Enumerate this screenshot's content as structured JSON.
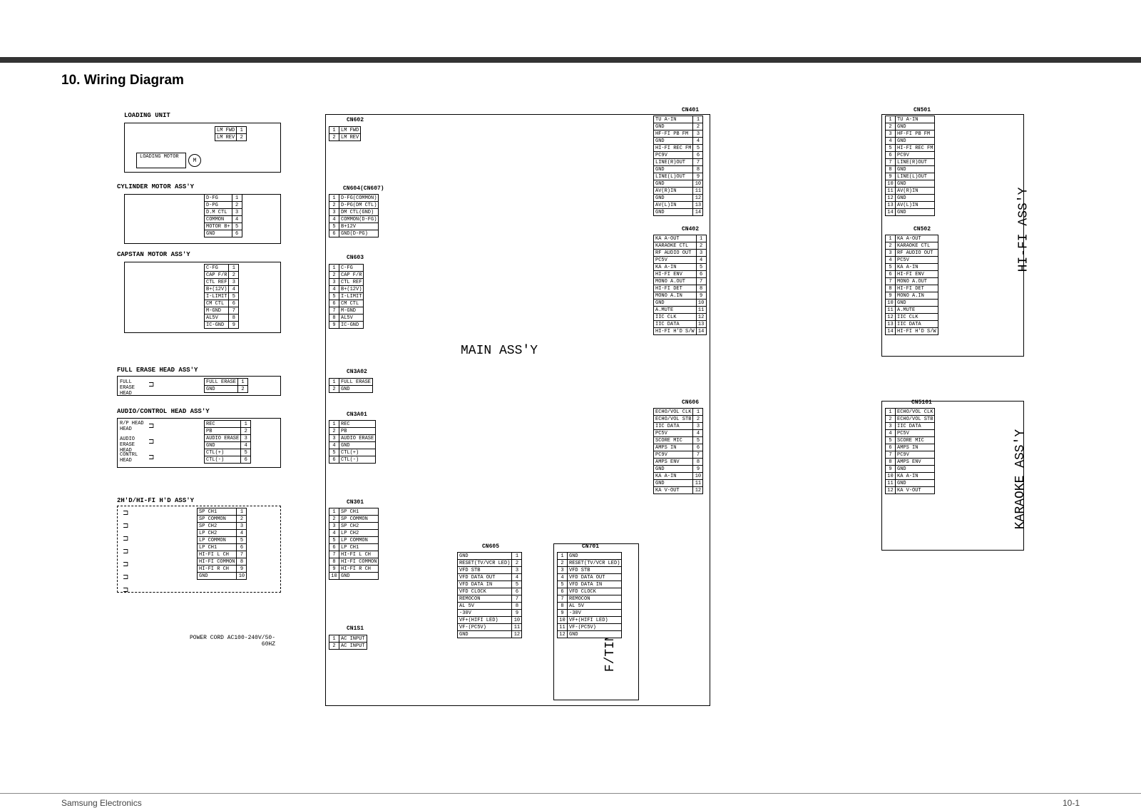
{
  "page": {
    "title": "10. Wiring Diagram",
    "footer_left": "Samsung Electronics",
    "footer_right": "10-1"
  },
  "diagram": {
    "main_assy": "MAIN ASS'Y",
    "ft_assy": "F/TIMER ASS'Y",
    "hifi_assy": "HI-FI ASS'Y",
    "karaoke_assy": "KARAOKE ASS'Y"
  },
  "sections": {
    "loading_unit": "LOADING UNIT",
    "loading_motor": "LOADING MOTOR",
    "cylinder_motor": "CYLINDER MOTOR ASS'Y",
    "capstan_motor": "CAPSTAN MOTOR ASS'Y",
    "full_erase": "FULL ERASE HEAD ASS'Y",
    "full_erase_head": "FULL ERASE HEAD",
    "audio_control": "AUDIO/CONTROL HEAD ASS'Y",
    "rp_head": "R/P HEAD HEAD",
    "audio_erase": "AUDIO ERASE HEAD",
    "control_head": "CONTRL HEAD",
    "hifi_hd": "2H'D/HI-FI H'D ASS'Y",
    "power_cord": "POWER CORD AC100-240V/50-60HZ"
  },
  "connectors": {
    "cn602": {
      "name": "CN602",
      "left": [
        {
          "n": "1",
          "t": "LM FWD"
        },
        {
          "n": "2",
          "t": "LM REV"
        }
      ],
      "right": [
        {
          "n": "1",
          "t": "LM FWD"
        },
        {
          "n": "2",
          "t": "LM REV"
        }
      ]
    },
    "cn604": {
      "name": "CN604(CN607)",
      "left": [
        {
          "n": "1",
          "t": "D-FG"
        },
        {
          "n": "2",
          "t": "D-PG"
        },
        {
          "n": "3",
          "t": "D.M CTL"
        },
        {
          "n": "4",
          "t": "COMMON"
        },
        {
          "n": "5",
          "t": "MOTOR B+"
        },
        {
          "n": "6",
          "t": "GND"
        }
      ],
      "right": [
        {
          "n": "1",
          "t": "D-FG(COMMON)"
        },
        {
          "n": "2",
          "t": "D-PG(DM CTL)"
        },
        {
          "n": "3",
          "t": "DM CTL(GND)"
        },
        {
          "n": "4",
          "t": "COMMON(D-FG)"
        },
        {
          "n": "5",
          "t": "B+12V"
        },
        {
          "n": "6",
          "t": "GND(D-PG)"
        }
      ]
    },
    "cn603": {
      "name": "CN603",
      "left": [
        {
          "n": "1",
          "t": "C-FG"
        },
        {
          "n": "2",
          "t": "CAP F/R"
        },
        {
          "n": "3",
          "t": "CTL REF"
        },
        {
          "n": "4",
          "t": "B+(12V)"
        },
        {
          "n": "5",
          "t": "I-LIMIT"
        },
        {
          "n": "6",
          "t": "CM CTL"
        },
        {
          "n": "7",
          "t": "M-GND"
        },
        {
          "n": "8",
          "t": "AL5V"
        },
        {
          "n": "9",
          "t": "IC-GND"
        }
      ],
      "right": [
        {
          "n": "1",
          "t": "C-FG"
        },
        {
          "n": "2",
          "t": "CAP F/R"
        },
        {
          "n": "3",
          "t": "CTL REF"
        },
        {
          "n": "4",
          "t": "B+(12V)"
        },
        {
          "n": "5",
          "t": "I-LIMIT"
        },
        {
          "n": "6",
          "t": "CM CTL"
        },
        {
          "n": "7",
          "t": "M-GND"
        },
        {
          "n": "8",
          "t": "AL5V"
        },
        {
          "n": "9",
          "t": "IC-GND"
        }
      ]
    },
    "cn3a02": {
      "name": "CN3A02",
      "left": [
        {
          "n": "1",
          "t": "FULL ERASE"
        },
        {
          "n": "2",
          "t": "GND"
        }
      ],
      "right": [
        {
          "n": "1",
          "t": "FULL ERASE"
        },
        {
          "n": "2",
          "t": "GND"
        }
      ]
    },
    "cn3a01": {
      "name": "CN3A01",
      "left": [
        {
          "n": "1",
          "t": "REC"
        },
        {
          "n": "2",
          "t": "PB"
        },
        {
          "n": "3",
          "t": "AUDIO ERASE"
        },
        {
          "n": "4",
          "t": "GND"
        },
        {
          "n": "5",
          "t": "CTL(+)"
        },
        {
          "n": "6",
          "t": "CTL(-)"
        }
      ],
      "right": [
        {
          "n": "1",
          "t": "REC"
        },
        {
          "n": "2",
          "t": "PB"
        },
        {
          "n": "3",
          "t": "AUDIO ERASE"
        },
        {
          "n": "4",
          "t": "GND"
        },
        {
          "n": "5",
          "t": "CTL(+)"
        },
        {
          "n": "6",
          "t": "CTL(-)"
        }
      ]
    },
    "cn301": {
      "name": "CN301",
      "left": [
        {
          "n": "1",
          "t": "SP CH1"
        },
        {
          "n": "2",
          "t": "SP COMMON"
        },
        {
          "n": "3",
          "t": "SP CH2"
        },
        {
          "n": "4",
          "t": "LP CH2"
        },
        {
          "n": "5",
          "t": "LP COMMON"
        },
        {
          "n": "6",
          "t": "LP CH1"
        },
        {
          "n": "7",
          "t": "HI-FI L CH"
        },
        {
          "n": "8",
          "t": "HI-FI COMMON"
        },
        {
          "n": "9",
          "t": "HI-FI R CH"
        },
        {
          "n": "10",
          "t": "GND"
        }
      ],
      "right": [
        {
          "n": "1",
          "t": "SP CH1"
        },
        {
          "n": "2",
          "t": "SP COMMON"
        },
        {
          "n": "3",
          "t": "SP CH2"
        },
        {
          "n": "4",
          "t": "LP CH2"
        },
        {
          "n": "5",
          "t": "LP COMMON"
        },
        {
          "n": "6",
          "t": "LP CH1"
        },
        {
          "n": "7",
          "t": "HI-FI L CH"
        },
        {
          "n": "8",
          "t": "HI-FI COMMON"
        },
        {
          "n": "9",
          "t": "HI-FI R CH"
        },
        {
          "n": "10",
          "t": "GND"
        }
      ]
    },
    "cn1s1": {
      "name": "CN1S1",
      "right": [
        {
          "n": "1",
          "t": "AC INPUT"
        },
        {
          "n": "2",
          "t": "AC INPUT"
        }
      ]
    },
    "cn605": {
      "name": "CN605",
      "pins": [
        {
          "n": "1",
          "t": "GND"
        },
        {
          "n": "2",
          "t": "RESET(TV/VCR LED)"
        },
        {
          "n": "3",
          "t": "VFD STB"
        },
        {
          "n": "4",
          "t": "VFD DATA OUT"
        },
        {
          "n": "5",
          "t": "VFD DATA IN"
        },
        {
          "n": "6",
          "t": "VFD CLOCK"
        },
        {
          "n": "7",
          "t": "REMOCON"
        },
        {
          "n": "8",
          "t": "AL 5V"
        },
        {
          "n": "9",
          "t": "-30V"
        },
        {
          "n": "10",
          "t": "VF+(HIFI LED)"
        },
        {
          "n": "11",
          "t": "VF-(PC5V)"
        },
        {
          "n": "12",
          "t": "GND"
        }
      ]
    },
    "cn701": {
      "name": "CN701",
      "pins": [
        {
          "n": "1",
          "t": "GND"
        },
        {
          "n": "2",
          "t": "RESET(TV/VCR LED)"
        },
        {
          "n": "3",
          "t": "VFD STB"
        },
        {
          "n": "4",
          "t": "VFD DATA OUT"
        },
        {
          "n": "5",
          "t": "VFD DATA IN"
        },
        {
          "n": "6",
          "t": "VFD CLOCK"
        },
        {
          "n": "7",
          "t": "REMOCON"
        },
        {
          "n": "8",
          "t": "AL 5V"
        },
        {
          "n": "9",
          "t": "-30V"
        },
        {
          "n": "10",
          "t": "VF+(HIFI LED)"
        },
        {
          "n": "11",
          "t": "VF-(PC5V)"
        },
        {
          "n": "12",
          "t": "GND"
        }
      ]
    },
    "cn401": {
      "name": "CN401",
      "pins": [
        {
          "n": "1",
          "t": "TU A-IN"
        },
        {
          "n": "2",
          "t": "GND"
        },
        {
          "n": "3",
          "t": "HF-FI PB FM"
        },
        {
          "n": "4",
          "t": "GND"
        },
        {
          "n": "5",
          "t": "HI-FI REC FM"
        },
        {
          "n": "6",
          "t": "PC9V"
        },
        {
          "n": "7",
          "t": "LINE(R)OUT"
        },
        {
          "n": "8",
          "t": "GND"
        },
        {
          "n": "9",
          "t": "LINE(L)OUT"
        },
        {
          "n": "10",
          "t": "GND"
        },
        {
          "n": "11",
          "t": "AV(R)IN"
        },
        {
          "n": "12",
          "t": "GND"
        },
        {
          "n": "13",
          "t": "AV(L)IN"
        },
        {
          "n": "14",
          "t": "GND"
        }
      ]
    },
    "cn501": {
      "name": "CN501",
      "pins": [
        {
          "n": "1",
          "t": "TU A-IN"
        },
        {
          "n": "2",
          "t": "GND"
        },
        {
          "n": "3",
          "t": "HF-FI PB FM"
        },
        {
          "n": "4",
          "t": "GND"
        },
        {
          "n": "5",
          "t": "HI-FI REC FM"
        },
        {
          "n": "6",
          "t": "PC9V"
        },
        {
          "n": "7",
          "t": "LINE(R)OUT"
        },
        {
          "n": "8",
          "t": "GND"
        },
        {
          "n": "9",
          "t": "LINE(L)OUT"
        },
        {
          "n": "10",
          "t": "GND"
        },
        {
          "n": "11",
          "t": "AV(R)IN"
        },
        {
          "n": "12",
          "t": "GND"
        },
        {
          "n": "13",
          "t": "AV(L)IN"
        },
        {
          "n": "14",
          "t": "GND"
        }
      ]
    },
    "cn402": {
      "name": "CN402",
      "pins": [
        {
          "n": "1",
          "t": "KA A-OUT"
        },
        {
          "n": "2",
          "t": "KARAOKE CTL"
        },
        {
          "n": "3",
          "t": "RF AUDIO OUT"
        },
        {
          "n": "4",
          "t": "PC5V"
        },
        {
          "n": "5",
          "t": "KA A-IN"
        },
        {
          "n": "6",
          "t": "HI-FI ENV"
        },
        {
          "n": "7",
          "t": "MONO A.OUT"
        },
        {
          "n": "8",
          "t": "HI-FI DET"
        },
        {
          "n": "9",
          "t": "MONO A.IN"
        },
        {
          "n": "10",
          "t": "GND"
        },
        {
          "n": "11",
          "t": "A.MUTE"
        },
        {
          "n": "12",
          "t": "IIC CLK"
        },
        {
          "n": "13",
          "t": "IIC DATA"
        },
        {
          "n": "14",
          "t": "HI-FI H'D S/W"
        }
      ]
    },
    "cn502": {
      "name": "CN502",
      "pins": [
        {
          "n": "1",
          "t": "KA A-OUT"
        },
        {
          "n": "2",
          "t": "KARAOKE CTL"
        },
        {
          "n": "3",
          "t": "RF AUDIO OUT"
        },
        {
          "n": "4",
          "t": "PC5V"
        },
        {
          "n": "5",
          "t": "KA A-IN"
        },
        {
          "n": "6",
          "t": "HI-FI ENV"
        },
        {
          "n": "7",
          "t": "MONO A.OUT"
        },
        {
          "n": "8",
          "t": "HI-FI DET"
        },
        {
          "n": "9",
          "t": "MONO A.IN"
        },
        {
          "n": "10",
          "t": "GND"
        },
        {
          "n": "11",
          "t": "A.MUTE"
        },
        {
          "n": "12",
          "t": "IIC CLK"
        },
        {
          "n": "13",
          "t": "IIC DATA"
        },
        {
          "n": "14",
          "t": "HI-FI H'D S/W"
        }
      ]
    },
    "cn606": {
      "name": "CN606",
      "pins": [
        {
          "n": "1",
          "t": "ECHO/VOL CLK"
        },
        {
          "n": "2",
          "t": "ECHO/VOL STB"
        },
        {
          "n": "3",
          "t": "IIC DATA"
        },
        {
          "n": "4",
          "t": "PC5V"
        },
        {
          "n": "5",
          "t": "SCORE MIC"
        },
        {
          "n": "6",
          "t": "AMPS IN"
        },
        {
          "n": "7",
          "t": "PC9V"
        },
        {
          "n": "8",
          "t": "AMPS ENV"
        },
        {
          "n": "9",
          "t": "GND"
        },
        {
          "n": "10",
          "t": "KA A-IN"
        },
        {
          "n": "11",
          "t": "GND"
        },
        {
          "n": "12",
          "t": "KA V-OUT"
        }
      ]
    },
    "cn5101": {
      "name": "CN5101",
      "pins": [
        {
          "n": "1",
          "t": "ECHO/VOL CLK"
        },
        {
          "n": "2",
          "t": "ECHO/VOL STB"
        },
        {
          "n": "3",
          "t": "IIC DATA"
        },
        {
          "n": "4",
          "t": "PC5V"
        },
        {
          "n": "5",
          "t": "SCORE MIC"
        },
        {
          "n": "6",
          "t": "AMPS IN"
        },
        {
          "n": "7",
          "t": "PC9V"
        },
        {
          "n": "8",
          "t": "AMPS ENV"
        },
        {
          "n": "9",
          "t": "GND"
        },
        {
          "n": "10",
          "t": "KA A-IN"
        },
        {
          "n": "11",
          "t": "GND"
        },
        {
          "n": "12",
          "t": "KA V-OUT"
        }
      ]
    }
  },
  "motor_symbol": "M"
}
